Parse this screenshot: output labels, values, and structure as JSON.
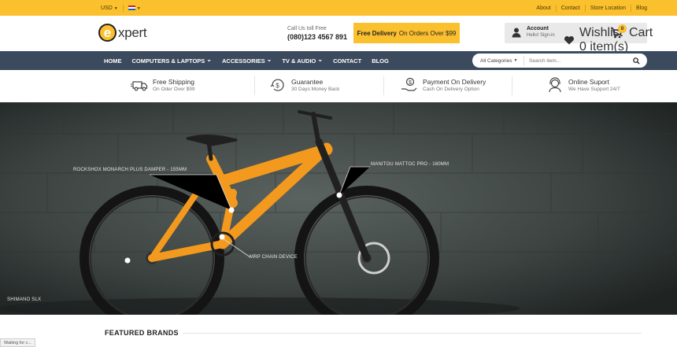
{
  "topbar": {
    "currency": "USD",
    "language_flag": "us-flag-icon",
    "links": [
      "About",
      "Contact",
      "Store Location",
      "Blog"
    ]
  },
  "header": {
    "logo_letter": "e",
    "logo_text": "xpert",
    "call_label": "Call Us toll Free",
    "phone": "(080)123 4567 891",
    "delivery_bold": "Free Delivery",
    "delivery_rest": "On Orders Over $99",
    "account_title": "Account",
    "account_sub": "Hello! Sign-in",
    "wishlist_title": "Wishlist",
    "wishlist_sub": "0 item(s)",
    "cart_label": "Cart",
    "cart_count": "0"
  },
  "nav": {
    "items": [
      {
        "label": "HOME",
        "dropdown": false
      },
      {
        "label": "COMPUTERS & LAPTOPS",
        "dropdown": true
      },
      {
        "label": "ACCESSORIES",
        "dropdown": true
      },
      {
        "label": "TV & AUDIO",
        "dropdown": true
      },
      {
        "label": "CONTACT",
        "dropdown": false
      },
      {
        "label": "BLOG",
        "dropdown": false
      }
    ],
    "search_category": "All Categories",
    "search_placeholder": "Search item..."
  },
  "features": [
    {
      "title": "Free Shipping",
      "sub": "On Oder Over $99",
      "icon": "truck-icon"
    },
    {
      "title": "Guarantee",
      "sub": "30 Days Money Back",
      "icon": "money-back-icon"
    },
    {
      "title": "Payment On Delivery",
      "sub": "Cash On Delivery Option",
      "icon": "cash-hand-icon"
    },
    {
      "title": "Online Suport",
      "sub": "We Have Support 24/7",
      "icon": "support-agent-icon"
    }
  ],
  "hero": {
    "callouts": {
      "damper": "ROCKSHOX MONARCH PLUS DAMPER - 155MM",
      "fork": "MANITOU MATTOC PRO - 160MM",
      "chain": "MRP CHAIN DEVICE",
      "drivetrain": "SHIMANO SLX"
    },
    "colors": {
      "frame": "#f39a1e",
      "accent": "#fbc02d"
    }
  },
  "brands": {
    "title": "FEATURED BRANDS"
  },
  "status_text": "Waiting for c..."
}
